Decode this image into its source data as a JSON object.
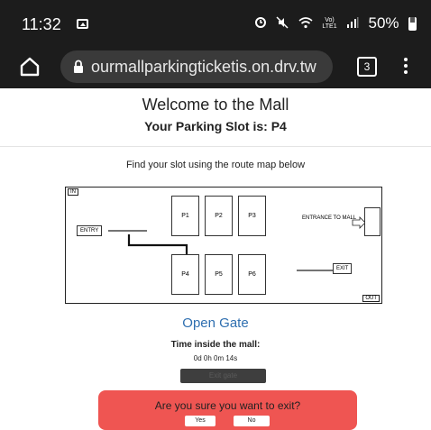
{
  "status_bar": {
    "time": "11:32",
    "network_top": "Vo)",
    "network_bottom": "LTE1",
    "battery": "50%"
  },
  "browser": {
    "url": "ourmallparkingticketis.on.drv.tw",
    "tab_count": "3"
  },
  "page": {
    "welcome": "Welcome to the Mall",
    "slot_prefix": "Your Parking Slot is:",
    "slot_value": "P4",
    "find_text": "Find your slot using the route map below"
  },
  "map": {
    "in_label": "IN",
    "out_label": "OUT",
    "entry_label": "ENTRY",
    "entrance_label": "ENTRANCE TO MALL",
    "exit_label": "EXIT",
    "slots": [
      "P1",
      "P2",
      "P3",
      "P4",
      "P5",
      "P6"
    ],
    "highlighted_slot": "P4"
  },
  "actions": {
    "open_gate": "Open Gate",
    "exit_gate": "Exit gate"
  },
  "timer": {
    "label": "Time inside the mall:",
    "value": "0d 0h 0m 14s"
  },
  "dialog": {
    "message": "Are you sure you want to exit?",
    "yes": "Yes",
    "no": "No"
  },
  "colors": {
    "status_bg": "#1c1c1c",
    "link": "#2f6fb0",
    "dialog_bg": "#ef5552"
  }
}
